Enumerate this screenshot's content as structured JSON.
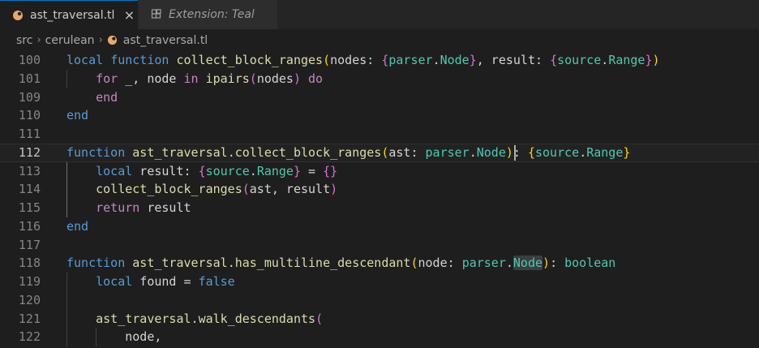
{
  "tabs": [
    {
      "label": "ast_traversal.tl",
      "icon": "teal-file-icon",
      "active": true,
      "close": "×"
    },
    {
      "label": "Extension: Teal",
      "icon": "extensions-icon",
      "active": false
    }
  ],
  "breadcrumb": {
    "items": [
      "src",
      "cerulean",
      "ast_traversal.tl"
    ],
    "separator": "›"
  },
  "colors": {
    "keyword": "#569cd6",
    "function": "#dcdcaa",
    "type": "#4ec9b0",
    "text": "#d4d4d4",
    "bracket_gold": "#ffd700",
    "bracket_purple": "#da70d6",
    "bracket_blue": "#179fff",
    "accent": "#007acc"
  },
  "editor": {
    "active_line": "112",
    "lines": [
      {
        "num": "100",
        "tokens": [
          [
            "kw",
            "local"
          ],
          [
            "pl",
            " "
          ],
          [
            "kw",
            "function"
          ],
          [
            "pl",
            " "
          ],
          [
            "fn",
            "collect_block_ranges"
          ],
          [
            "br1",
            "("
          ],
          [
            "pl",
            "nodes: "
          ],
          [
            "br2",
            "{"
          ],
          [
            "ty",
            "parser"
          ],
          [
            "pl",
            "."
          ],
          [
            "ty",
            "Node"
          ],
          [
            "br2",
            "}"
          ],
          [
            "pl",
            ", result: "
          ],
          [
            "br2",
            "{"
          ],
          [
            "ty",
            "source"
          ],
          [
            "pl",
            "."
          ],
          [
            "ty",
            "Range"
          ],
          [
            "br2",
            "}"
          ],
          [
            "br1",
            ")"
          ]
        ]
      },
      {
        "num": "101",
        "tokens": [
          [
            "pl",
            "    "
          ],
          [
            "ctl",
            "for"
          ],
          [
            "pl",
            " _, node "
          ],
          [
            "ctl",
            "in"
          ],
          [
            "pl",
            " "
          ],
          [
            "fn",
            "ipairs"
          ],
          [
            "br2",
            "("
          ],
          [
            "pl",
            "nodes"
          ],
          [
            "br2",
            ")"
          ],
          [
            "pl",
            " "
          ],
          [
            "ctl",
            "do"
          ]
        ]
      },
      {
        "num": "109",
        "tokens": [
          [
            "pl",
            "    "
          ],
          [
            "ctl",
            "end"
          ]
        ]
      },
      {
        "num": "110",
        "tokens": [
          [
            "kw",
            "end"
          ]
        ]
      },
      {
        "num": "111",
        "tokens": []
      },
      {
        "num": "112",
        "tokens": [
          [
            "kw",
            "function"
          ],
          [
            "pl",
            " "
          ],
          [
            "fn",
            "ast_traversal"
          ],
          [
            "pl",
            "."
          ],
          [
            "fn",
            "collect_block_ranges"
          ],
          [
            "br1",
            "("
          ],
          [
            "pl",
            "ast: "
          ],
          [
            "ty",
            "parser"
          ],
          [
            "pl",
            "."
          ],
          [
            "ty",
            "Node"
          ],
          [
            "br1",
            ")"
          ],
          [
            "pl",
            ": "
          ],
          [
            "br1",
            "{"
          ],
          [
            "ty",
            "source"
          ],
          [
            "pl",
            "."
          ],
          [
            "ty",
            "Range"
          ],
          [
            "br1",
            "}"
          ]
        ]
      },
      {
        "num": "113",
        "tokens": [
          [
            "pl",
            "    "
          ],
          [
            "kw",
            "local"
          ],
          [
            "pl",
            " result: "
          ],
          [
            "br2",
            "{"
          ],
          [
            "ty",
            "source"
          ],
          [
            "pl",
            "."
          ],
          [
            "ty",
            "Range"
          ],
          [
            "br2",
            "}"
          ],
          [
            "pl",
            " = "
          ],
          [
            "br2",
            "{}"
          ]
        ]
      },
      {
        "num": "114",
        "tokens": [
          [
            "pl",
            "    "
          ],
          [
            "fn",
            "collect_block_ranges"
          ],
          [
            "br2",
            "("
          ],
          [
            "pl",
            "ast, result"
          ],
          [
            "br2",
            ")"
          ]
        ]
      },
      {
        "num": "115",
        "tokens": [
          [
            "pl",
            "    "
          ],
          [
            "ctl",
            "return"
          ],
          [
            "pl",
            " result"
          ]
        ]
      },
      {
        "num": "116",
        "tokens": [
          [
            "kw",
            "end"
          ]
        ]
      },
      {
        "num": "117",
        "tokens": []
      },
      {
        "num": "118",
        "tokens": [
          [
            "kw",
            "function"
          ],
          [
            "pl",
            " "
          ],
          [
            "fn",
            "ast_traversal"
          ],
          [
            "pl",
            "."
          ],
          [
            "fn",
            "has_multiline_descendant"
          ],
          [
            "br1",
            "("
          ],
          [
            "pl",
            "node: "
          ],
          [
            "ty",
            "parser"
          ],
          [
            "pl",
            "."
          ],
          [
            "tyhl",
            "Node"
          ],
          [
            "br1",
            ")"
          ],
          [
            "pl",
            ": "
          ],
          [
            "ty",
            "boolean"
          ]
        ]
      },
      {
        "num": "119",
        "tokens": [
          [
            "pl",
            "    "
          ],
          [
            "kw",
            "local"
          ],
          [
            "pl",
            " found = "
          ],
          [
            "kw",
            "false"
          ]
        ]
      },
      {
        "num": "120",
        "tokens": []
      },
      {
        "num": "121",
        "tokens": [
          [
            "pl",
            "    "
          ],
          [
            "fn",
            "ast_traversal"
          ],
          [
            "pl",
            "."
          ],
          [
            "fn",
            "walk_descendants"
          ],
          [
            "br2",
            "("
          ]
        ]
      },
      {
        "num": "122",
        "tokens": [
          [
            "pl",
            "        node,"
          ]
        ]
      }
    ]
  }
}
